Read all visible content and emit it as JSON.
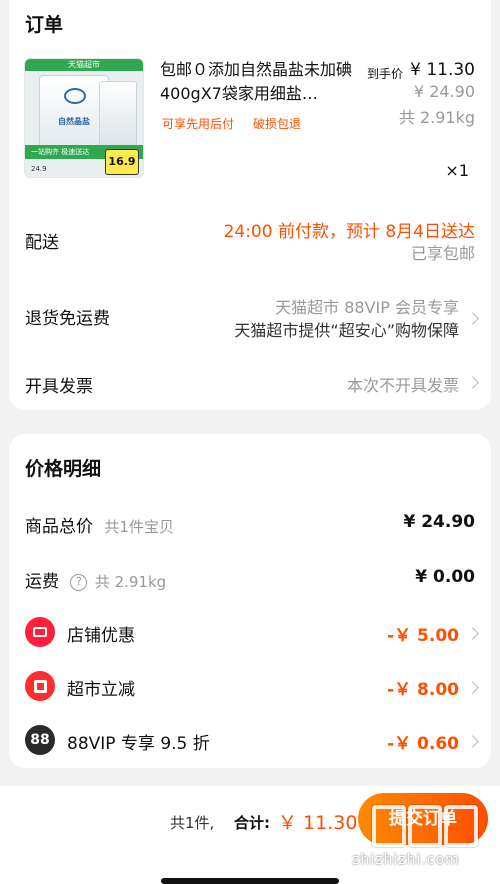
{
  "order": {
    "title": "订单",
    "product": {
      "image_store_label": "天猫超市",
      "image_bag_text": "自然晶盐",
      "image_banner": "一站购齐 极速送达",
      "image_price_tag": "16.9",
      "image_small_price": "24.9",
      "title": "包邮０添加自然晶盐未加碘400gX7袋家用细盐…",
      "price_label": "到手价",
      "price_now": "¥ 11.30",
      "price_original": "¥ 24.90",
      "weight": "共 2.91kg",
      "tags": [
        "可享先用后付",
        "破损包退"
      ],
      "quantity": "×1"
    },
    "delivery": {
      "label": "配送",
      "promise": "24:00 前付款，预计 8月4日送达",
      "note": "已享包邮"
    },
    "returns": {
      "label": "退货免运费",
      "line1": "天猫超市 88VIP 会员专享",
      "line2": "天猫超市提供“超安心”购物保障"
    },
    "invoice": {
      "label": "开具发票",
      "value": "本次不开具发票"
    }
  },
  "price_detail": {
    "title": "价格明细",
    "subtotal": {
      "label": "商品总价",
      "note": "共1件宝贝",
      "value": "¥ 24.90"
    },
    "shipping": {
      "label": "运费",
      "help": "?",
      "note": "共 2.91kg",
      "value": "¥ 0.00"
    },
    "shop_discount": {
      "label": "店铺优惠",
      "value": "-￥ 5.00",
      "icon": "ticket-icon"
    },
    "market_discount": {
      "label": "超市立减",
      "value": "-￥ 8.00",
      "icon": "supermarket-icon"
    },
    "vip_discount": {
      "label": "88VIP 专享 9.5 折",
      "value": "-￥ 0.60",
      "icon": "vip88-icon",
      "icon_text": "88"
    }
  },
  "footer": {
    "count": "共1件,",
    "total_label": "合计:",
    "total_amount": "￥ 11.30",
    "submit_label": "提交订单",
    "watermark": "zhizhizhi.com"
  },
  "colors": {
    "accent": "#ff5000",
    "gray_text": "#999999",
    "background": "#f2f2f2",
    "card": "#ffffff"
  }
}
